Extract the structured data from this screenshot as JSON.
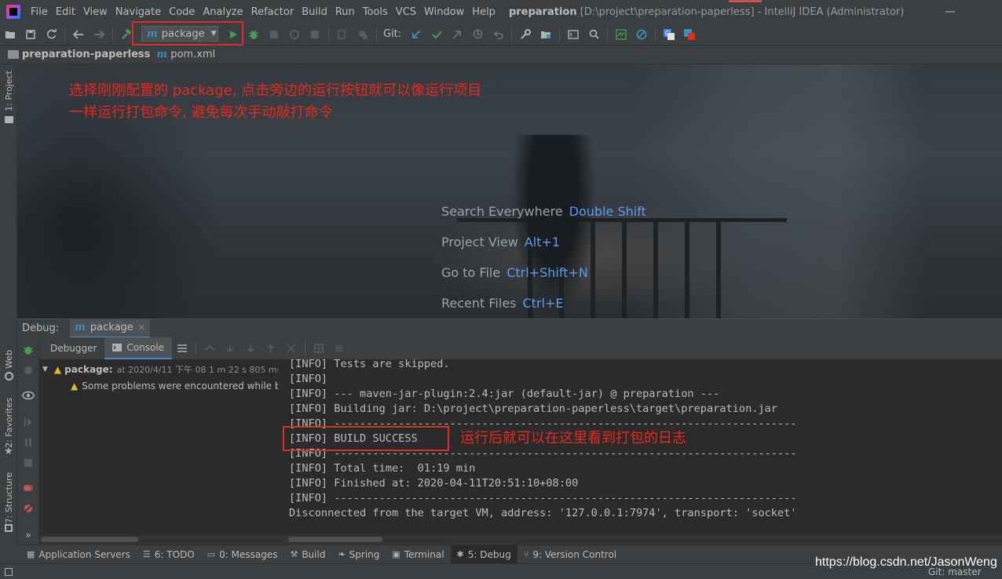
{
  "menu": {
    "items": [
      "File",
      "Edit",
      "View",
      "Navigate",
      "Code",
      "Analyze",
      "Refactor",
      "Build",
      "Run",
      "Tools",
      "VCS",
      "Window",
      "Help"
    ],
    "title_bold": "preparation",
    "title_rest": "[D:\\project\\preparation-paperless] - IntelliJ IDEA (Administrator)",
    "window_controls": [
      "—",
      "☐",
      "✕"
    ]
  },
  "toolbar": {
    "run_config": "package",
    "run_config_icon": "m",
    "git_label": "Git:"
  },
  "breadcrumb": {
    "project": "preparation-paperless",
    "file_icon": "m",
    "file": "pom.xml"
  },
  "left_stripe": {
    "project_tab": "1: Project",
    "web_tab": "Web",
    "favorites_tab": "2: Favorites",
    "structure_tab": "7: Structure"
  },
  "annotations": {
    "top_line1": "选择刚刚配置的 package, 点击旁边的运行按钮就可以像运行项目",
    "top_line2": "一样运行打包命令, 避免每次手动敲打命令",
    "console_note": "运行后就可以在这里看到打包的日志"
  },
  "welcome_hints": [
    {
      "label": "Search Everywhere",
      "key": "Double Shift"
    },
    {
      "label": "Project View",
      "key": "Alt+1"
    },
    {
      "label": "Go to File",
      "key": "Ctrl+Shift+N"
    },
    {
      "label": "Recent Files",
      "key": "Ctrl+E"
    }
  ],
  "debug": {
    "label": "Debug:",
    "tab_icon": "m",
    "tab": "package",
    "subtabs": [
      "Debugger",
      "Console"
    ],
    "frames": {
      "root": "package:",
      "root_time": "at 2020/4/11 下午 08 1 m 22 s 805 ms",
      "warning": "Some problems were encountered while b"
    },
    "console_lines": [
      "[INFO] Tests are skipped.",
      "[INFO]",
      "[INFO] --- maven-jar-plugin:2.4:jar (default-jar) @ preparation ---",
      "[INFO] Building jar: D:\\project\\preparation-paperless\\target\\preparation.jar",
      "[INFO] ------------------------------------------------------------------------",
      "[INFO] BUILD SUCCESS",
      "[INFO] ------------------------------------------------------------------------",
      "[INFO] Total time:  01:19 min",
      "[INFO] Finished at: 2020-04-11T20:51:10+08:00",
      "[INFO] ------------------------------------------------------------------------",
      "Disconnected from the target VM, address: '127.0.0.1:7974', transport: 'socket'"
    ]
  },
  "bottom_tools": [
    {
      "icon": "server-icon",
      "label": "Application Servers"
    },
    {
      "icon": "todo-icon",
      "label": "6: TODO"
    },
    {
      "icon": "messages-icon",
      "label": "0: Messages"
    },
    {
      "icon": "build-icon",
      "label": "Build"
    },
    {
      "icon": "spring-icon",
      "label": "Spring"
    },
    {
      "icon": "terminal-icon",
      "label": "Terminal"
    },
    {
      "icon": "debug-icon",
      "label": "5: Debug"
    },
    {
      "icon": "vcs-icon",
      "label": "9: Version Control"
    }
  ],
  "status": {
    "git_branch": "Git: master"
  },
  "watermark": "https://blog.csdn.net/JasonWeng",
  "colors": {
    "annotation_red": "#e8291c",
    "shortcut_blue": "#589df6",
    "maven_blue": "#3592c4",
    "run_green": "#499c54"
  }
}
